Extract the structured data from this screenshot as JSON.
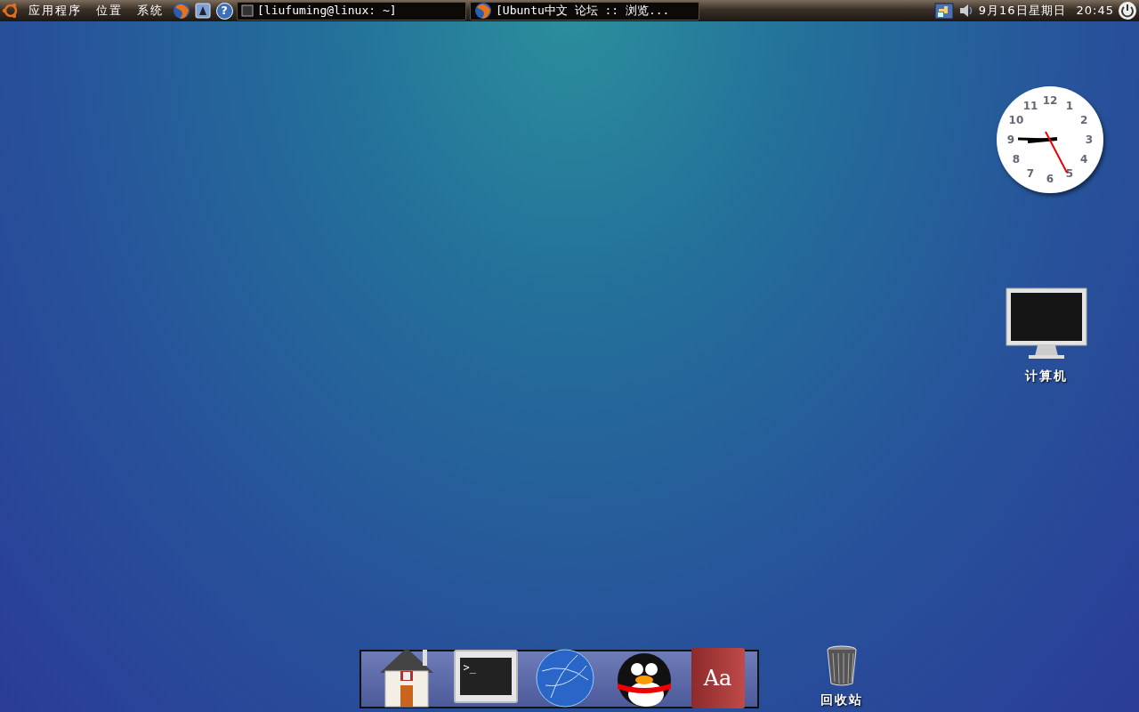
{
  "top_panel": {
    "menus": [
      "应用程序",
      "位置",
      "系统"
    ],
    "launchers": [
      {
        "kind": "browser"
      },
      {
        "kind": "mail"
      },
      {
        "kind": "help",
        "glyph": "?"
      }
    ],
    "tasks": [
      {
        "kind": "terminal",
        "title": "[liufuming@linux: ~]"
      },
      {
        "kind": "browser",
        "title": "[Ubuntu中文 论坛 :: 浏览..."
      }
    ],
    "date": "9月16日星期日",
    "time": "20:45"
  },
  "clock_widget": {
    "numerals": [
      "12",
      "1",
      "2",
      "3",
      "4",
      "5",
      "6",
      "7",
      "8",
      "9",
      "10",
      "11"
    ]
  },
  "desktop_icons": [
    {
      "kind": "computer",
      "label": "计算机"
    },
    {
      "kind": "trash",
      "label": "回收站"
    }
  ],
  "dock": [
    {
      "kind": "home"
    },
    {
      "kind": "terminal",
      "glyph": ">_"
    },
    {
      "kind": "globe"
    },
    {
      "kind": "penguin"
    },
    {
      "kind": "dictionary",
      "glyph": "Aa"
    }
  ]
}
